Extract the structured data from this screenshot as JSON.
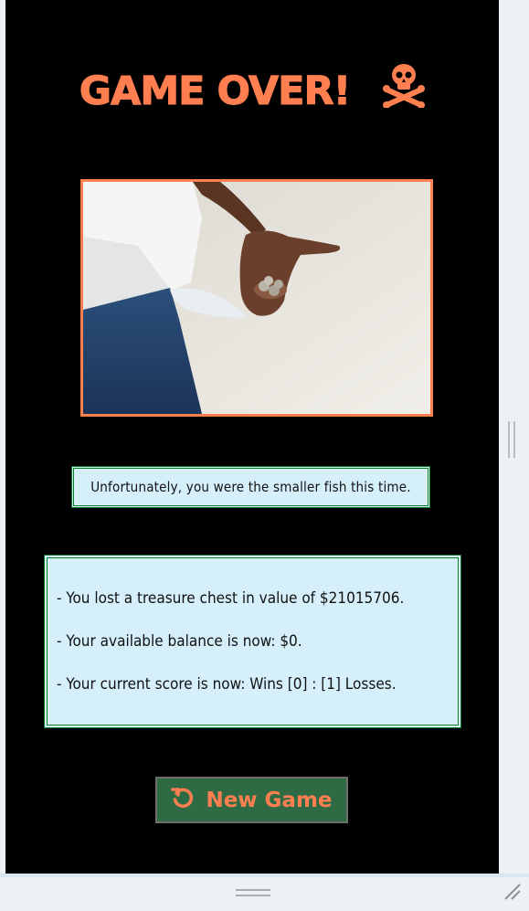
{
  "game": {
    "title": "GAME OVER!",
    "title_icon": "skull-crossbones-icon",
    "message": "Unfortunately, you were the smaller fish this time.",
    "results": [
      "- You lost a treasure chest in value of $21015706.",
      "- Your available balance is now: $0.",
      "- Your current score is now: Wins [0] : [1] Losses."
    ],
    "new_game_label": "New Game",
    "new_game_icon": "restart-icon"
  },
  "colors": {
    "accent": "#ff7f50",
    "panel_bg": "#000000",
    "box_bg": "#d6f0fb",
    "box_border": "#0a7a2a",
    "button_bg": "#2e6b45"
  }
}
